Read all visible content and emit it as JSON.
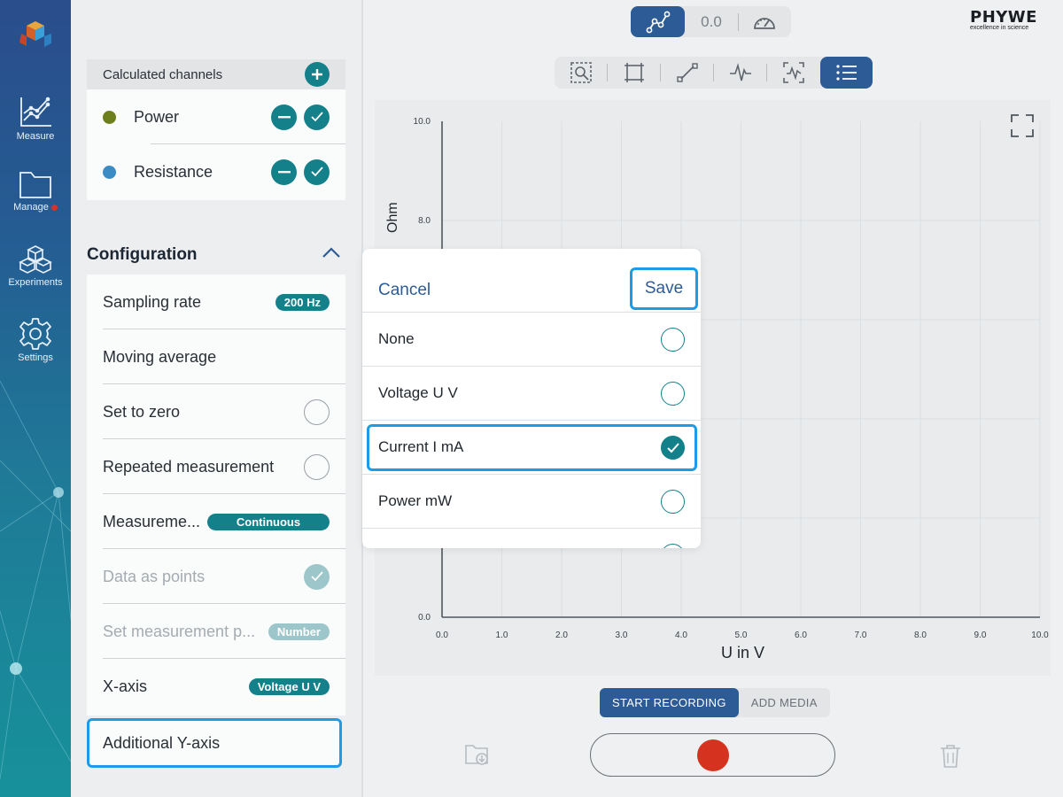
{
  "nav": {
    "items": [
      {
        "label": "Measure",
        "icon": "chart-line-icon"
      },
      {
        "label": "Manage",
        "icon": "folder-icon",
        "notification": true
      },
      {
        "label": "Experiments",
        "icon": "cubes-icon"
      },
      {
        "label": "Settings",
        "icon": "gear-icon"
      }
    ]
  },
  "topbar": {
    "value_display": "0.0",
    "logo": {
      "title": "PHYWE",
      "tagline": "excellence in science"
    }
  },
  "channels": {
    "header": "Calculated channels",
    "items": [
      {
        "name": "Power",
        "color": "#6d7f1c"
      },
      {
        "name": "Resistance",
        "color": "#3b8bc4"
      }
    ]
  },
  "configuration": {
    "title": "Configuration",
    "rows": [
      {
        "label": "Sampling rate",
        "badge": "200 Hz"
      },
      {
        "label": "Moving average"
      },
      {
        "label": "Set to zero"
      },
      {
        "label": "Repeated measurement"
      },
      {
        "label": "Measureme...",
        "badge": "Continuous"
      },
      {
        "label": "Data as points"
      },
      {
        "label": "Set measurement p...",
        "badge": "Number"
      },
      {
        "label": "X-axis",
        "badge": "Voltage U V"
      },
      {
        "label": "Additional Y-axis"
      }
    ]
  },
  "chart_data": {
    "type": "line",
    "xlabel": "U in V",
    "ylabel": "Ohm",
    "xlim": [
      0,
      10
    ],
    "ylim": [
      0,
      10
    ],
    "x_ticks": [
      "0.0",
      "1.0",
      "2.0",
      "3.0",
      "4.0",
      "5.0",
      "6.0",
      "7.0",
      "8.0",
      "9.0",
      "10.0"
    ],
    "y_ticks": [
      "0.0",
      "8.0",
      "10.0"
    ],
    "grid": true,
    "series": []
  },
  "recording": {
    "tabs": [
      "START RECORDING",
      "ADD MEDIA"
    ],
    "active_tab": 0
  },
  "modal": {
    "cancel_label": "Cancel",
    "save_label": "Save",
    "options": [
      {
        "label": "None",
        "checked": false
      },
      {
        "label": "Voltage U V",
        "checked": false
      },
      {
        "label": "Current I mA",
        "checked": true
      },
      {
        "label": "Power mW",
        "checked": false
      }
    ]
  },
  "colors": {
    "accent": "#14808a",
    "primary": "#2d5b96",
    "highlight": "#1d9be6",
    "record": "#d5321f"
  }
}
